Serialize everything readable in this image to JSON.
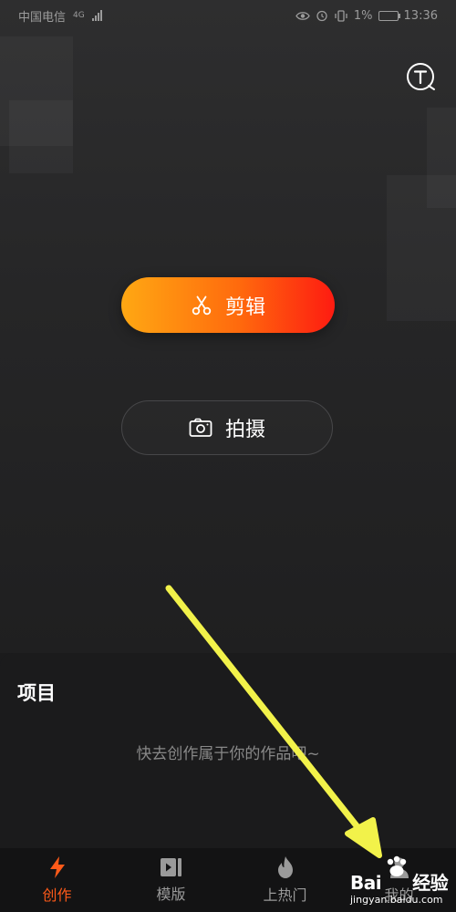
{
  "status_bar": {
    "carrier": "中国电信",
    "network": "4G",
    "battery_percent": "1%",
    "time": "13:36"
  },
  "header": {
    "tutorial_icon": "t-question-icon"
  },
  "actions": {
    "edit_label": "剪辑",
    "edit_icon": "scissors-icon",
    "shoot_label": "拍摄",
    "shoot_icon": "camera-icon"
  },
  "projects": {
    "title": "项目",
    "empty_hint": "快去创作属于你的作品吧~"
  },
  "tabs": [
    {
      "label": "创作",
      "icon": "lightning-icon",
      "active": true
    },
    {
      "label": "模版",
      "icon": "video-play-icon",
      "active": false
    },
    {
      "label": "上热门",
      "icon": "flame-icon",
      "active": false
    },
    {
      "label": "我的",
      "icon": "user-icon",
      "active": false
    }
  ],
  "watermark": {
    "brand": "Bai",
    "product": "经验",
    "url": "jingyan.baidu.com"
  },
  "colors": {
    "accent": "#ff5a19",
    "edit_gradient_start": "#ffa813",
    "edit_gradient_end": "#fe1b11",
    "annotation_arrow": "#f2f24a"
  }
}
